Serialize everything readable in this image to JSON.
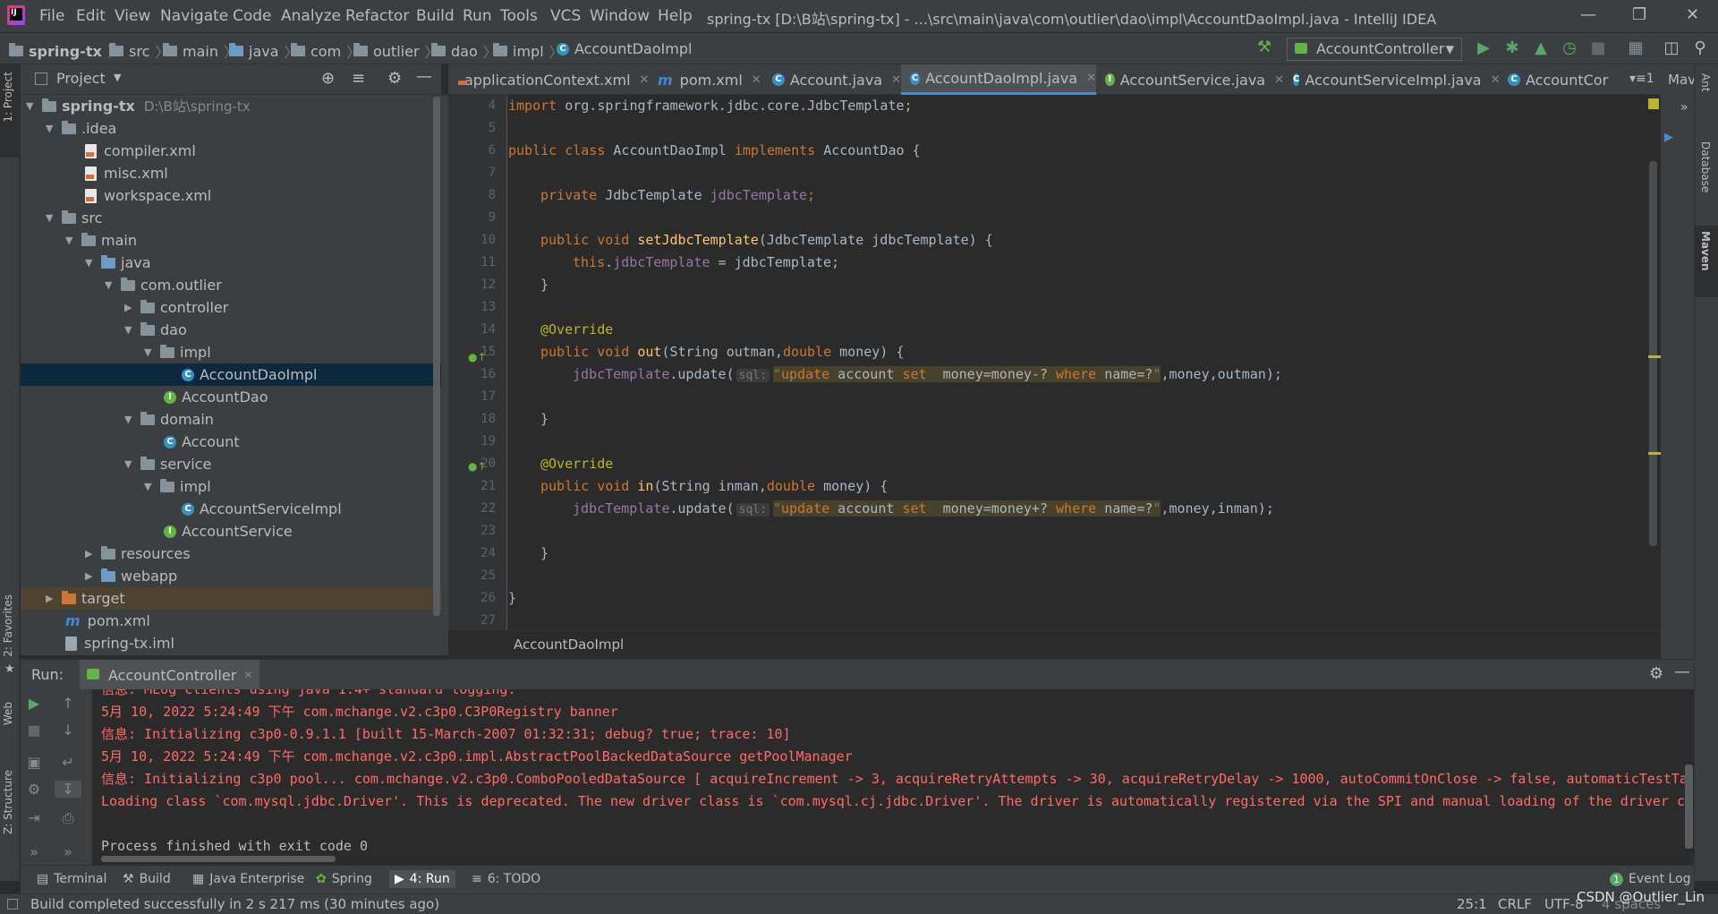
{
  "window": {
    "title": "spring-tx [D:\\B站\\spring-tx] - ...\\src\\main\\java\\com\\outlier\\dao\\impl\\AccountDaoImpl.java - IntelliJ IDEA",
    "menu": [
      "File",
      "Edit",
      "View",
      "Navigate",
      "Code",
      "Analyze",
      "Refactor",
      "Build",
      "Run",
      "Tools",
      "VCS",
      "Window",
      "Help"
    ]
  },
  "breadcrumb": [
    "spring-tx",
    "src",
    "main",
    "java",
    "com",
    "outlier",
    "dao",
    "impl",
    "AccountDaoImpl"
  ],
  "run_config": "AccountController",
  "left_stripe": {
    "project": "1: Project",
    "favorites": "2: Favorites",
    "web": "Web",
    "structure": "Z: Structure"
  },
  "right_stripe": {
    "ant": "Ant",
    "database": "Database",
    "maven": "Maven",
    "maven_short": "Mav"
  },
  "project_panel": {
    "title": "Project",
    "tree": [
      {
        "label": "spring-tx",
        "hint": "D:\\B站\\spring-tx"
      },
      {
        "label": ".idea"
      },
      {
        "label": "compiler.xml"
      },
      {
        "label": "misc.xml"
      },
      {
        "label": "workspace.xml"
      },
      {
        "label": "src"
      },
      {
        "label": "main"
      },
      {
        "label": "java"
      },
      {
        "label": "com.outlier"
      },
      {
        "label": "controller"
      },
      {
        "label": "dao"
      },
      {
        "label": "impl"
      },
      {
        "label": "AccountDaoImpl"
      },
      {
        "label": "AccountDao"
      },
      {
        "label": "domain"
      },
      {
        "label": "Account"
      },
      {
        "label": "service"
      },
      {
        "label": "impl"
      },
      {
        "label": "AccountServiceImpl"
      },
      {
        "label": "AccountService"
      },
      {
        "label": "resources"
      },
      {
        "label": "webapp"
      },
      {
        "label": "target"
      },
      {
        "label": "pom.xml"
      },
      {
        "label": "spring-tx.iml"
      }
    ]
  },
  "editor_tabs": [
    "applicationContext.xml",
    "pom.xml",
    "Account.java",
    "AccountDaoImpl.java",
    "AccountService.java",
    "AccountServiceImpl.java",
    "AccountCor"
  ],
  "editor": {
    "line_numbers": [
      "4",
      "5",
      "6",
      "7",
      "8",
      "9",
      "10",
      "11",
      "12",
      "13",
      "14",
      "15",
      "16",
      "17",
      "18",
      "19",
      "20",
      "21",
      "22",
      "23",
      "24",
      "25",
      "26",
      "27"
    ],
    "code": {
      "l4_kw": "import",
      "l4_rest": " org.springframework.jdbc.core.JdbcTemplate;",
      "l6_kw1": "public class",
      "l6_name": " AccountDaoImpl ",
      "l6_kw2": "implements",
      "l6_rest": " AccountDao {",
      "l8_kw": "private",
      "l8_type": " JdbcTemplate ",
      "l8_fld": "jdbcTemplate",
      "l8_end": ";",
      "l10_kw": "public void",
      "l10_fn": "setJdbcTemplate",
      "l10_rest": "(JdbcTemplate jdbcTemplate) {",
      "l11_kw": "this",
      "l11_dot": ".",
      "l11_fld": "jdbcTemplate",
      "l11_rest": " = jdbcTemplate;",
      "brace": "}",
      "ann": "@Override",
      "l15_kw": "public void",
      "l15_fn": "out",
      "l15_p1": "(String outman,",
      "l15_kw2": "double",
      "l15_p2": " money) {",
      "upd_fld": "jdbcTemplate",
      "upd_call": ".update(",
      "sql_hint": "sql:",
      "q_open": "\"",
      "q_close": "\"",
      "s_update": "update",
      "s_account": " account ",
      "s_set": "set",
      "s_money_out": "  money=money-? ",
      "s_where": "where",
      "s_name": " name=?",
      "s_money_in": "  money=money+? ",
      "l16_tail": ",money,outman);",
      "l21_kw": "public void",
      "l21_fn": "in",
      "l21_p1": "(String inman,",
      "l21_kw2": "double",
      "l21_p2": " money) {",
      "l22_tail": ",money,inman);"
    },
    "bottom_breadcrumb": "AccountDaoImpl"
  },
  "run_panel": {
    "label": "Run:",
    "tab": "AccountController",
    "console": [
      "信息: MLog clients using java 1.4+ standard logging.",
      "5月 10, 2022 5:24:49 下午 com.mchange.v2.c3p0.C3P0Registry banner",
      "信息: Initializing c3p0-0.9.1.1 [built 15-March-2007 01:32:31; debug? true; trace: 10]",
      "5月 10, 2022 5:24:49 下午 com.mchange.v2.c3p0.impl.AbstractPoolBackedDataSource getPoolManager",
      "信息: Initializing c3p0 pool... com.mchange.v2.c3p0.ComboPooledDataSource [ acquireIncrement -> 3, acquireRetryAttempts -> 30, acquireRetryDelay -> 1000, autoCommitOnClose -> false, automaticTestTab",
      "Loading class `com.mysql.jdbc.Driver'. This is deprecated. The new driver class is `com.mysql.cj.jdbc.Driver'. The driver is automatically registered via the SPI and manual loading of the driver cla",
      "",
      "Process finished with exit code 0"
    ]
  },
  "tool_windows": [
    "Terminal",
    "Build",
    "Java Enterprise",
    "Spring",
    "4: Run",
    "6: TODO",
    "Event Log"
  ],
  "status": {
    "message": "Build completed successfully in 2 s 217 ms (30 minutes ago)",
    "position": "25:1",
    "line_sep": "CRLF",
    "encoding": "UTF-8",
    "indent": "4 spaces",
    "watermark": "CSDN @Outlier_Lin",
    "event_count": "1"
  }
}
